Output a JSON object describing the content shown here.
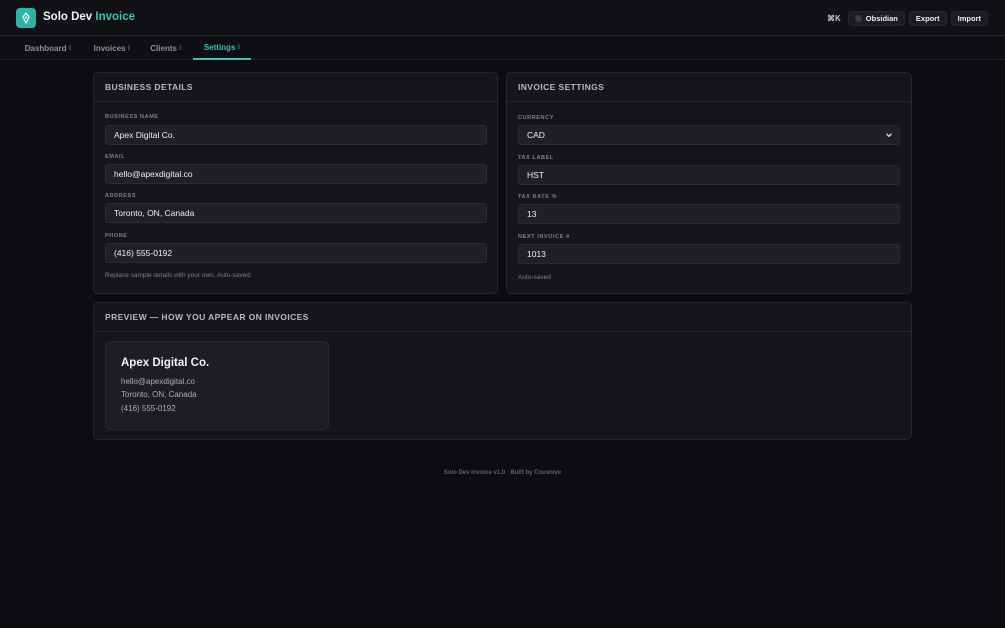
{
  "header": {
    "brand_main": "Solo Dev",
    "brand_accent": "Invoice",
    "shortcut": "⌘K",
    "theme_label": "Obsidian",
    "export_label": "Export",
    "import_label": "Import",
    "icons": {
      "logo": "pen-nib-icon",
      "theme": "theme-dot-icon"
    }
  },
  "nav": {
    "tabs": [
      {
        "label": "Dashboard",
        "caret": "▯",
        "active": false
      },
      {
        "label": "Invoices",
        "caret": "▯",
        "active": false
      },
      {
        "label": "Clients",
        "caret": "▯",
        "active": false
      },
      {
        "label": "Settings",
        "caret": "▯",
        "active": true
      }
    ]
  },
  "business": {
    "title": "BUSINESS DETAILS",
    "fields": [
      {
        "label": "BUSINESS NAME",
        "value": "Apex Digital Co."
      },
      {
        "label": "EMAIL",
        "value": "hello@apexdigital.co"
      },
      {
        "label": "ADDRESS",
        "value": "Toronto, ON, Canada"
      },
      {
        "label": "PHONE",
        "value": "(416) 555-0192"
      }
    ],
    "note": "Replace sample details with your own. Auto-saved."
  },
  "invoice_settings": {
    "title": "INVOICE SETTINGS",
    "fields": [
      {
        "label": "CURRENCY",
        "value": "CAD"
      },
      {
        "label": "TAX LABEL",
        "value": "HST"
      },
      {
        "label": "TAX RATE %",
        "value": "13"
      },
      {
        "label": "NEXT INVOICE #",
        "value": "1013"
      }
    ],
    "note": "Auto-saved"
  },
  "preview": {
    "title": "PREVIEW — HOW YOU APPEAR ON INVOICES",
    "name": "Apex Digital Co.",
    "email": "hello@apexdigital.co",
    "address": "Toronto, ON, Canada",
    "phone": "(416) 555-0192"
  },
  "footer": "Solo Dev Invoice v1.0 · Built by Cousnive",
  "colors": {
    "accent": "#35c4b1",
    "background": "#0c0d10",
    "card": "#15161b"
  }
}
